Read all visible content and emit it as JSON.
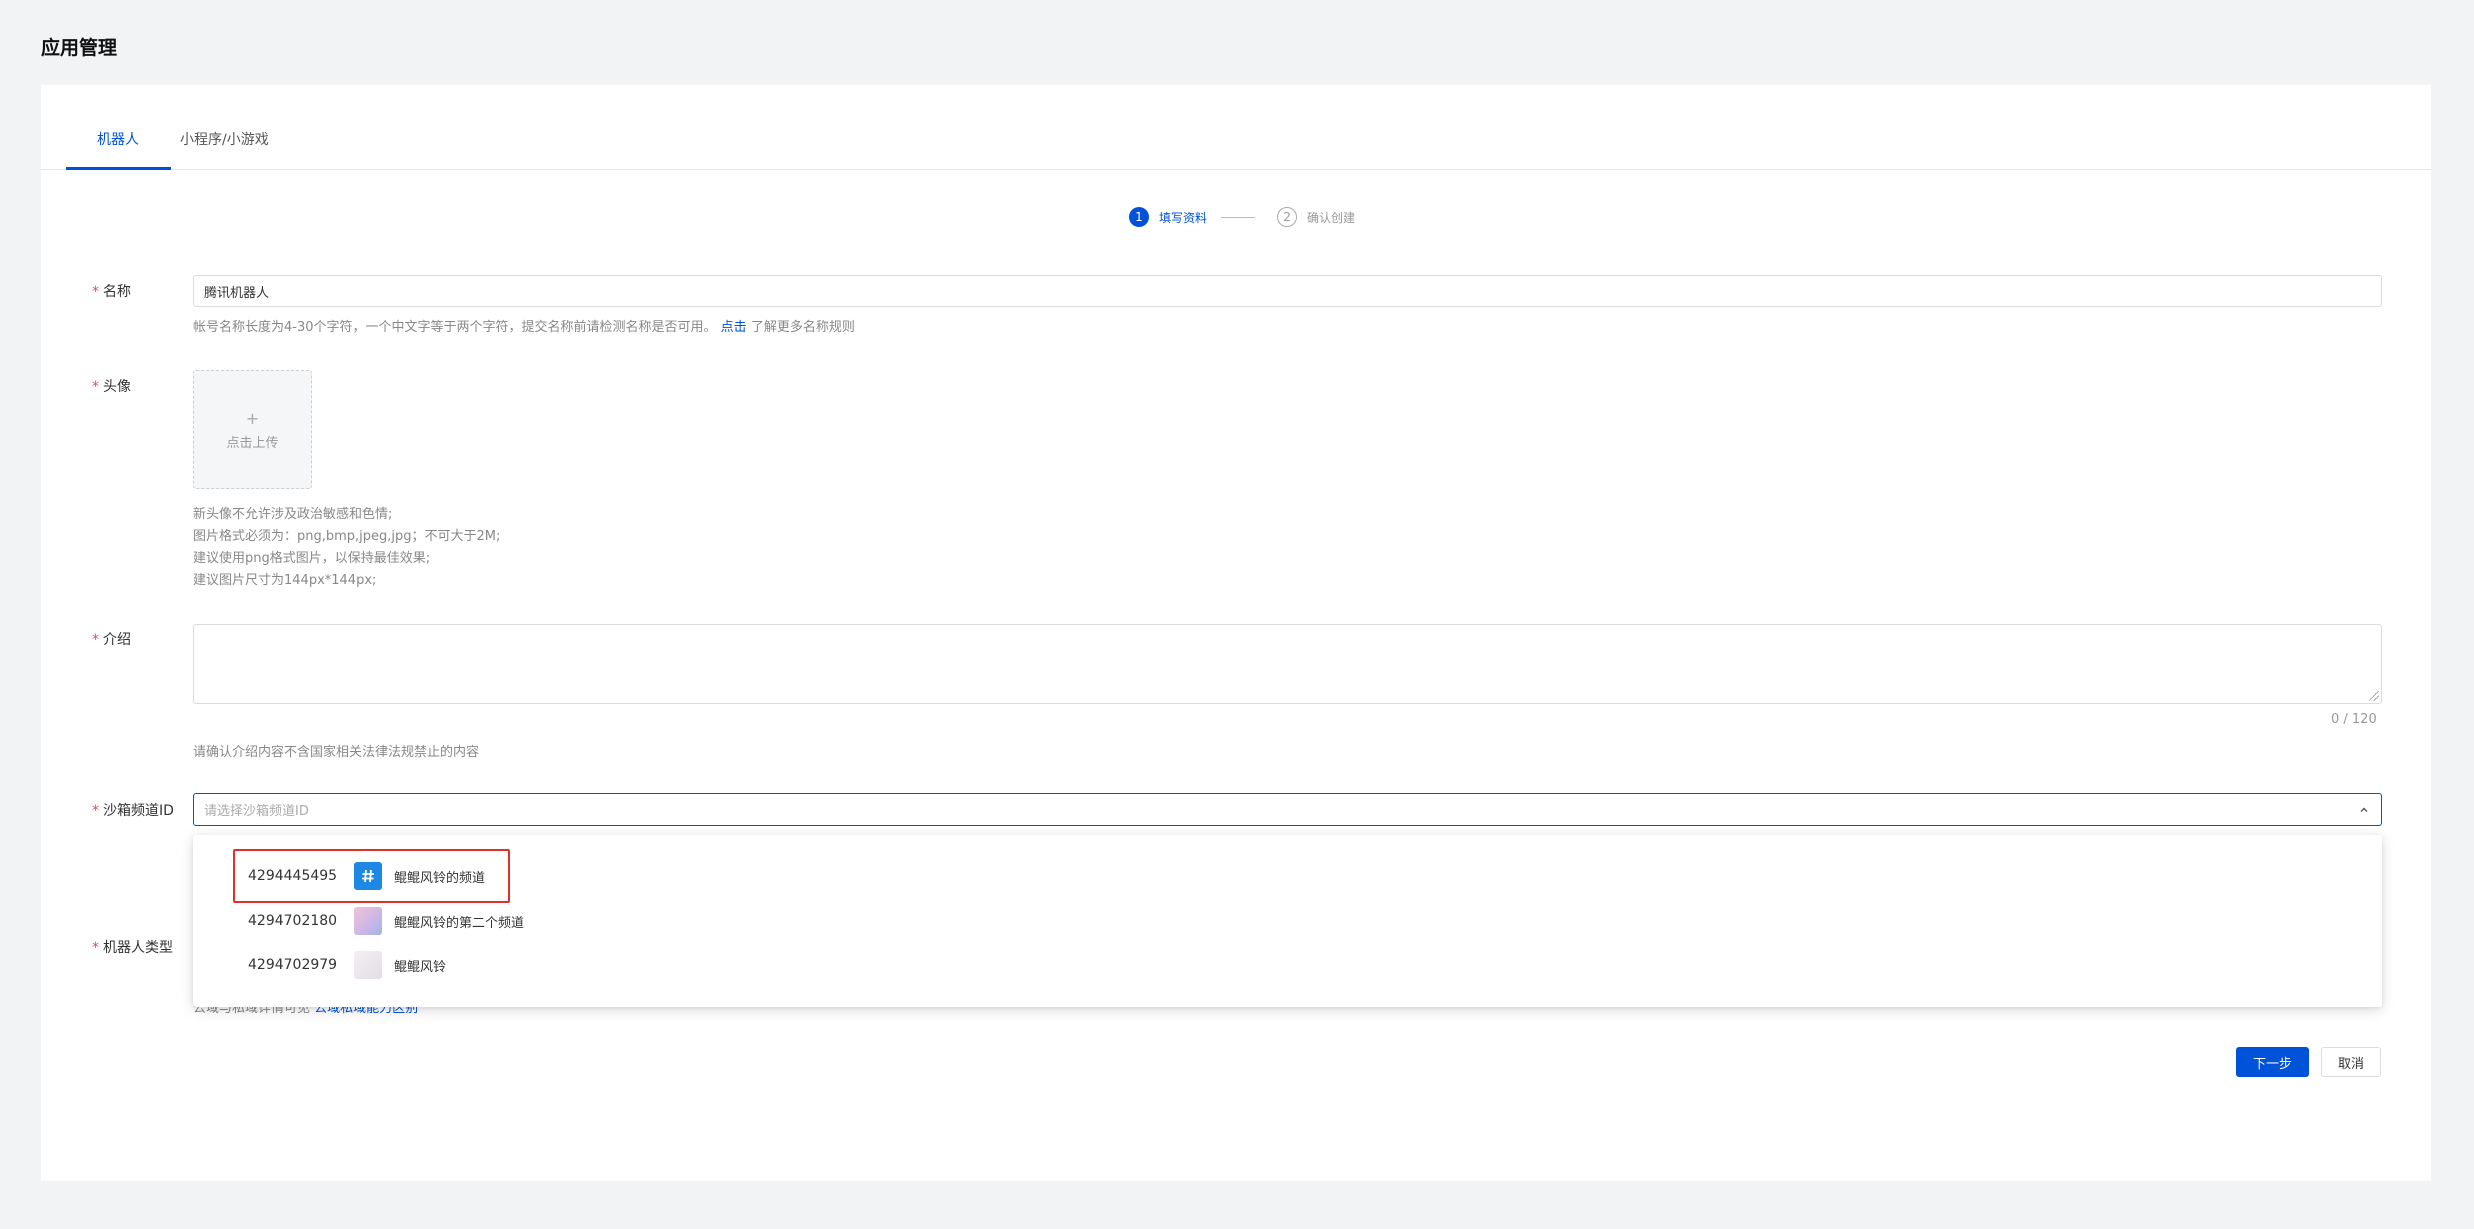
{
  "page": {
    "title": "应用管理"
  },
  "tabs": [
    {
      "label": "机器人",
      "active": true
    },
    {
      "label": "小程序/小游戏",
      "active": false
    }
  ],
  "steps": [
    {
      "num": "1",
      "label": "填写资料",
      "active": true
    },
    {
      "num": "2",
      "label": "确认创建",
      "active": false
    }
  ],
  "form": {
    "name": {
      "label": "名称",
      "value": "腾讯机器人",
      "help": "帐号名称长度为4-30个字符，一个中文字等于两个字符，提交名称前请检测名称是否可用。",
      "help_link": "点击",
      "help_suffix": "了解更多名称规则"
    },
    "avatar": {
      "label": "头像",
      "plus": "+",
      "upload_text": "点击上传",
      "help_lines": [
        "新头像不允许涉及政治敏感和色情;",
        "图片格式必须为：png,bmp,jpeg,jpg；不可大于2M;",
        "建议使用png格式图片，以保持最佳效果;",
        "建议图片尺寸为144px*144px;"
      ]
    },
    "intro": {
      "label": "介绍",
      "counter": "0 / 120",
      "help": "请确认介绍内容不含国家相关法律法规禁止的内容"
    },
    "channel": {
      "label": "沙箱频道ID",
      "placeholder": "请选择沙箱频道ID",
      "options": [
        {
          "id": "4294445495",
          "name": "鲲鲲风铃的频道",
          "icon": "hash-icon",
          "highlighted": true
        },
        {
          "id": "4294702180",
          "name": "鲲鲲风铃的第二个频道",
          "icon": "channel-avatar-icon",
          "highlighted": false
        },
        {
          "id": "4294702979",
          "name": "鲲鲲风铃",
          "icon": "channel-avatar-icon",
          "highlighted": false
        }
      ]
    },
    "bot_type": {
      "label": "机器人类型",
      "help": "公域与私域详情可见",
      "help_link": "公域私域能力区别"
    }
  },
  "buttons": {
    "next": "下一步",
    "cancel": "取消"
  },
  "colors": {
    "primary": "#0052d9",
    "required": "#e34d59",
    "highlight": "#e0302b"
  }
}
